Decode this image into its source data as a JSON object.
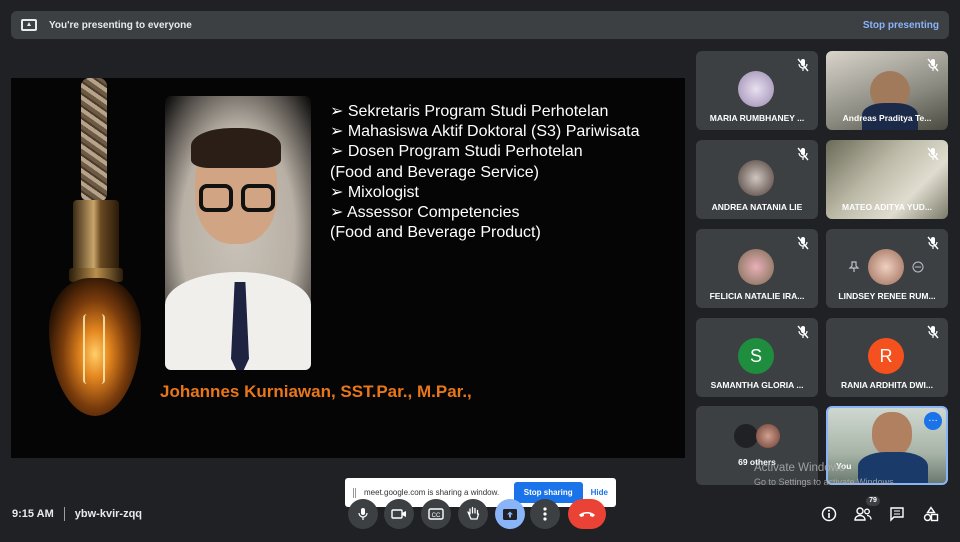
{
  "banner": {
    "message": "You're presenting to everyone",
    "stop_label": "Stop presenting"
  },
  "slide": {
    "bullets": [
      "➢ Sekretaris Program Studi Perhotelan",
      "➢ Mahasiswa Aktif Doktoral (S3) Pariwisata",
      "➢ Dosen Program Studi Perhotelan",
      "(Food and Beverage Service)",
      "➢ Mixologist",
      "➢ Assessor Competencies",
      "(Food and Beverage Product)"
    ],
    "presenter_name": "Johannes Kurniawan, SST.Par., M.Par.,"
  },
  "participants": [
    {
      "name": "MARIA RUMBHANEY ..."
    },
    {
      "name": "Andreas Praditya Te..."
    },
    {
      "name": "ANDREA NATANIA LIE"
    },
    {
      "name": "MATEO ADITYA YUD..."
    },
    {
      "name": "FELICIA NATALIE IRA..."
    },
    {
      "name": "LINDSEY RENEE RUM..."
    },
    {
      "name": "SAMANTHA GLORIA ...",
      "initial": "S",
      "color": "#1e8e3e"
    },
    {
      "name": "RANIA ARDHITA DWI...",
      "initial": "R",
      "color": "#f4511e"
    },
    {
      "name": "69 others"
    },
    {
      "name": "You"
    }
  ],
  "share_bar": {
    "text": "meet.google.com is sharing a window.",
    "stop_label": "Stop sharing",
    "hide_label": "Hide"
  },
  "meeting": {
    "time": "9:15 AM",
    "code": "ybw-kvir-zqq"
  },
  "people_count": "79",
  "watermark": {
    "title": "Activate Windows",
    "subtitle": "Go to Settings to activate Windows."
  },
  "colors": {
    "accent": "#8ab4f8",
    "end_call": "#ea4335",
    "background": "#202124",
    "presenter_name": "#e8761a"
  }
}
